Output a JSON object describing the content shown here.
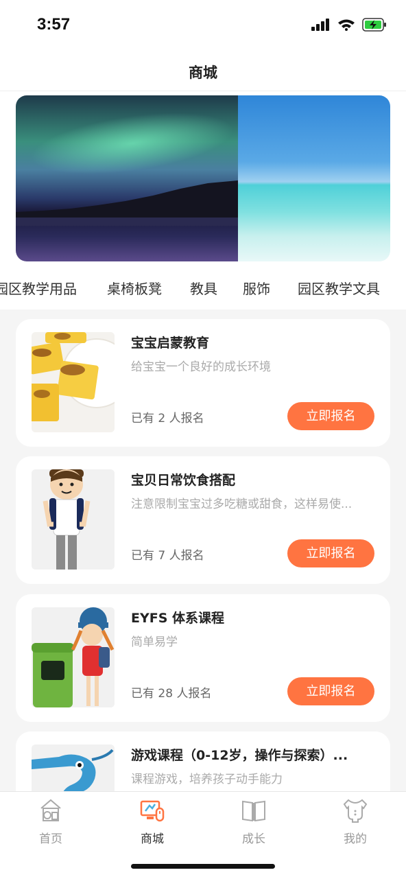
{
  "status": {
    "time": "3:57"
  },
  "header": {
    "title": "商城"
  },
  "categories": [
    "园区教学用品",
    "桌椅板凳",
    "教具",
    "服饰",
    "园区教学文具"
  ],
  "courses": [
    {
      "title": "宝宝启蒙教育",
      "desc": "给宝宝一个良好的成长环境",
      "count": "已有 2 人报名",
      "button": "立即报名"
    },
    {
      "title": "宝贝日常饮食搭配",
      "desc": "注意限制宝宝过多吃糖或甜食，这样易使...",
      "count": "已有 7 人报名",
      "button": "立即报名"
    },
    {
      "title": "EYFS 体系课程",
      "desc": "简单易学",
      "count": "已有 28 人报名",
      "button": "立即报名"
    },
    {
      "title": "游戏课程（0-12岁，操作与探索）...",
      "desc": "课程游戏，培养孩子动手能力"
    }
  ],
  "tabs": [
    {
      "label": "首页",
      "icon": "home-icon"
    },
    {
      "label": "商城",
      "icon": "mall-icon"
    },
    {
      "label": "成长",
      "icon": "book-icon"
    },
    {
      "label": "我的",
      "icon": "baby-clothes-icon"
    }
  ],
  "colors": {
    "accent": "#ff7441",
    "background": "#f5f5f5"
  }
}
